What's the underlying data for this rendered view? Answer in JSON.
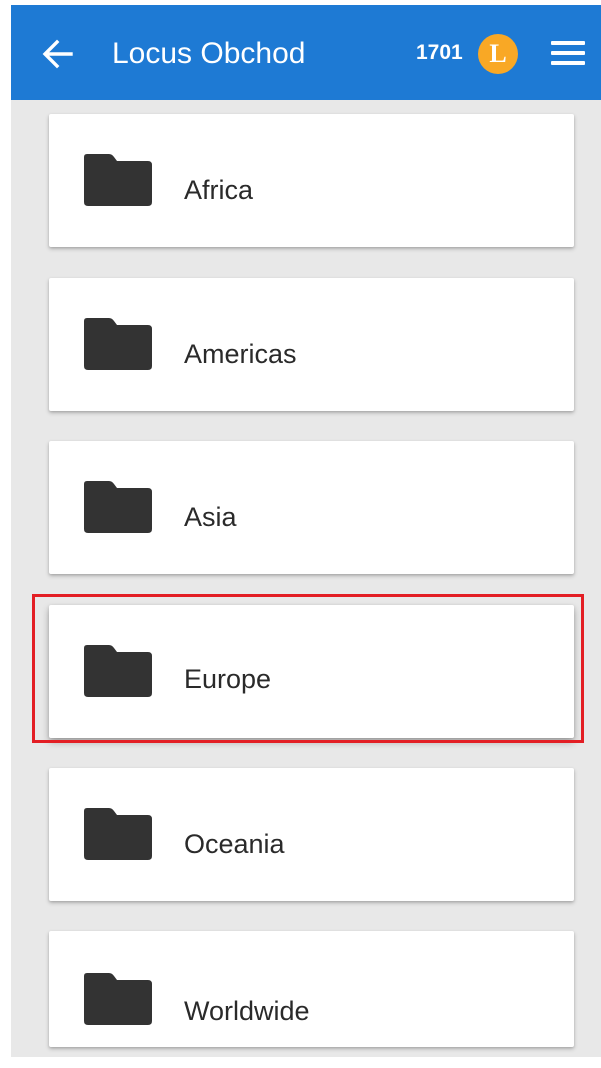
{
  "header": {
    "title": "Locus Obchod",
    "points": "1701",
    "coin_letter": "L"
  },
  "regions": [
    {
      "label": "Africa"
    },
    {
      "label": "Americas"
    },
    {
      "label": "Asia"
    },
    {
      "label": "Europe"
    },
    {
      "label": "Oceania"
    },
    {
      "label": "Worldwide"
    }
  ],
  "icons": {
    "back": "arrow-left-icon",
    "menu": "hamburger-menu-icon",
    "folder": "folder-icon",
    "coin": "locus-coin-icon"
  },
  "colors": {
    "appbar": "#1e7ad4",
    "coin": "#f9a825",
    "highlight": "#e31e24",
    "background": "#e8e8e8",
    "folder": "#333333"
  },
  "highlighted_region": "Europe"
}
